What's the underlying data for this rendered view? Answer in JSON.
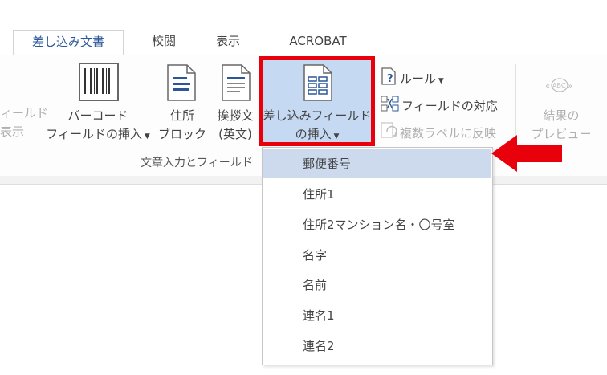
{
  "tabs": [
    {
      "label": "差し込み文書",
      "active": true
    },
    {
      "label": "校閲",
      "active": false
    },
    {
      "label": "表示",
      "active": false
    },
    {
      "label": "ACROBAT",
      "active": false
    }
  ],
  "ribbon": {
    "left_partial": {
      "line1": "ィールド",
      "line2": "表示"
    },
    "barcode": {
      "line1": "バーコード",
      "line2": "フィールドの挿入"
    },
    "address_block": {
      "line1": "住所",
      "line2": "ブロック"
    },
    "greeting": {
      "line1": "挨拶文",
      "line2": "(英文)"
    },
    "insert_field": {
      "line1": "差し込みフィールド",
      "line2": "の挿入"
    },
    "rules_label": "ルール",
    "match_fields_label": "フィールドの対応",
    "update_labels_label": "複数ラベルに反映",
    "preview": {
      "line1": "結果の",
      "line2": "プレビュー",
      "icon_text": "ABC"
    },
    "group_label": "文章入力とフィールド"
  },
  "dropdown_items": [
    {
      "label": "郵便番号",
      "hover": true
    },
    {
      "label": "住所1"
    },
    {
      "label": "住所2マンション名・〇号室"
    },
    {
      "label": "名字"
    },
    {
      "label": "名前"
    },
    {
      "label": "連名1"
    },
    {
      "label": "連名2"
    }
  ],
  "colors": {
    "highlight_border": "#e8000b",
    "arrow": "#e8000b",
    "active_tab_text": "#2b579a"
  }
}
